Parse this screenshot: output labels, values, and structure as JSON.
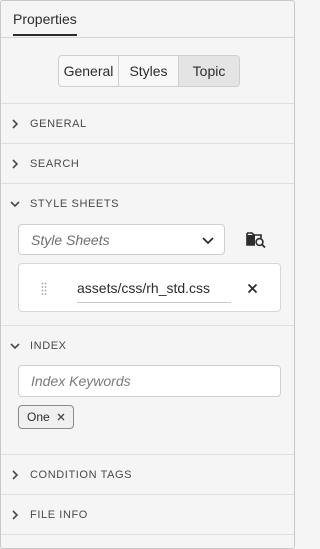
{
  "panel": {
    "title": "Properties"
  },
  "tabs": [
    {
      "label": "General"
    },
    {
      "label": "Styles"
    },
    {
      "label": "Topic",
      "selected": true
    }
  ],
  "sections": {
    "general": {
      "label": "GENERAL",
      "expanded": false
    },
    "search": {
      "label": "SEARCH",
      "expanded": false
    },
    "style_sheets": {
      "label": "STYLE SHEETS",
      "expanded": true
    },
    "index": {
      "label": "INDEX",
      "expanded": true
    },
    "condition_tags": {
      "label": "CONDITION TAGS",
      "expanded": false
    },
    "file_info": {
      "label": "FILE INFO",
      "expanded": false
    }
  },
  "style_sheets": {
    "dropdown_placeholder": "Style Sheets",
    "files": [
      {
        "path": "assets/css/rh_std.css"
      }
    ],
    "icons": {
      "browse": "folder-search-icon",
      "remove": "close-icon",
      "drag": "drag-handle-icon"
    }
  },
  "index": {
    "input_placeholder": "Index Keywords",
    "input_value": "",
    "keywords": [
      {
        "label": "One"
      }
    ]
  },
  "colors": {
    "background": "#f5f5f5",
    "selected_tab": "#e4e4e4",
    "text": "#2c2c2c",
    "section_label": "#4a4a4a"
  }
}
